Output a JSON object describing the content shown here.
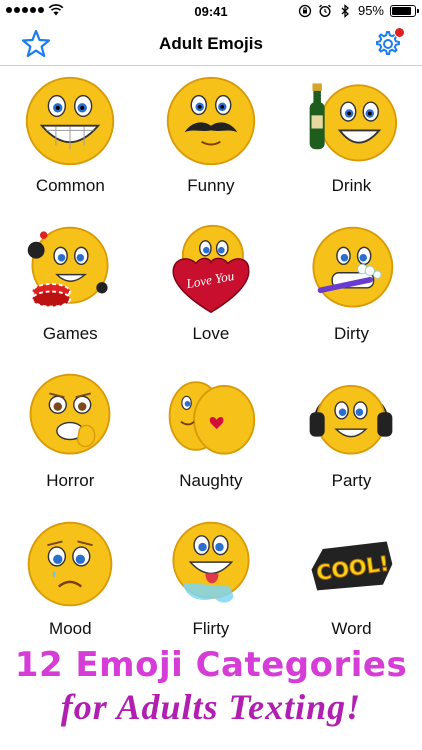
{
  "status_bar": {
    "time": "09:41",
    "battery": "95%"
  },
  "nav": {
    "title": "Adult Emojis",
    "star_icon": "star-icon",
    "settings_icon": "gear-icon"
  },
  "categories": [
    {
      "label": "Common",
      "icon": "grinning-face-icon"
    },
    {
      "label": "Funny",
      "icon": "mustache-face-icon"
    },
    {
      "label": "Drink",
      "icon": "champagne-face-icon"
    },
    {
      "label": "Games",
      "icon": "poker-chips-face-icon"
    },
    {
      "label": "Love",
      "icon": "love-heart-face-icon"
    },
    {
      "label": "Dirty",
      "icon": "toothbrush-face-icon"
    },
    {
      "label": "Horror",
      "icon": "scared-face-icon"
    },
    {
      "label": "Naughty",
      "icon": "naughty-bottom-icon"
    },
    {
      "label": "Party",
      "icon": "headphones-face-icon"
    },
    {
      "label": "Mood",
      "icon": "sad-face-icon"
    },
    {
      "label": "Flirty",
      "icon": "drooling-face-icon"
    },
    {
      "label": "Word",
      "icon": "cool-word-icon"
    }
  ],
  "love_text": "Love You",
  "word_text": "COOL!",
  "promo": {
    "line1": "12 Emoji Categories",
    "line2": "for Adults Texting!"
  },
  "colors": {
    "accent": "#1e7cf2",
    "face_yellow": "#f6c21a",
    "promo_pink": "#d63cd6"
  }
}
